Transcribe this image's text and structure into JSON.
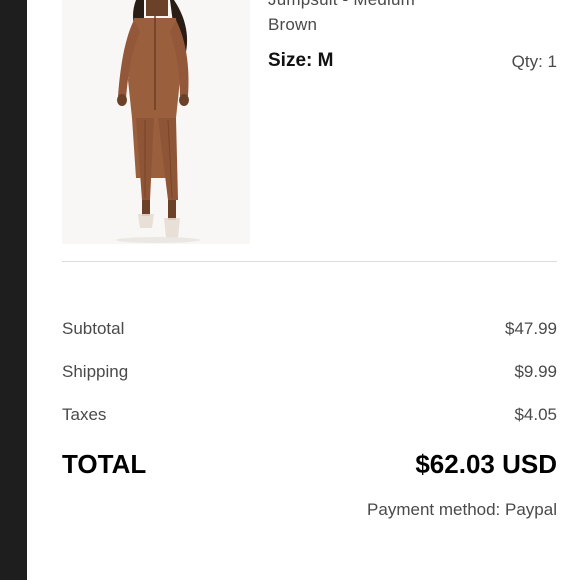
{
  "item": {
    "title_line1": "Jumpsuit - Medium",
    "title_line2": "Brown",
    "size": "Size: M",
    "qty": "Qty: 1",
    "image_icon": "product-photo"
  },
  "summary": {
    "subtotal_label": "Subtotal",
    "subtotal_value": "$47.99",
    "shipping_label": "Shipping",
    "shipping_value": "$9.99",
    "taxes_label": "Taxes",
    "taxes_value": "$4.05",
    "total_label": "TOTAL",
    "total_value": "$62.03 USD",
    "payment_method": "Payment method: Paypal"
  },
  "colors": {
    "sidebar": "#1e1e1e",
    "text_muted": "#4a4a4a",
    "text_strong": "#000000",
    "divider": "#dcdcdc",
    "garment": "#9a5f3d"
  }
}
